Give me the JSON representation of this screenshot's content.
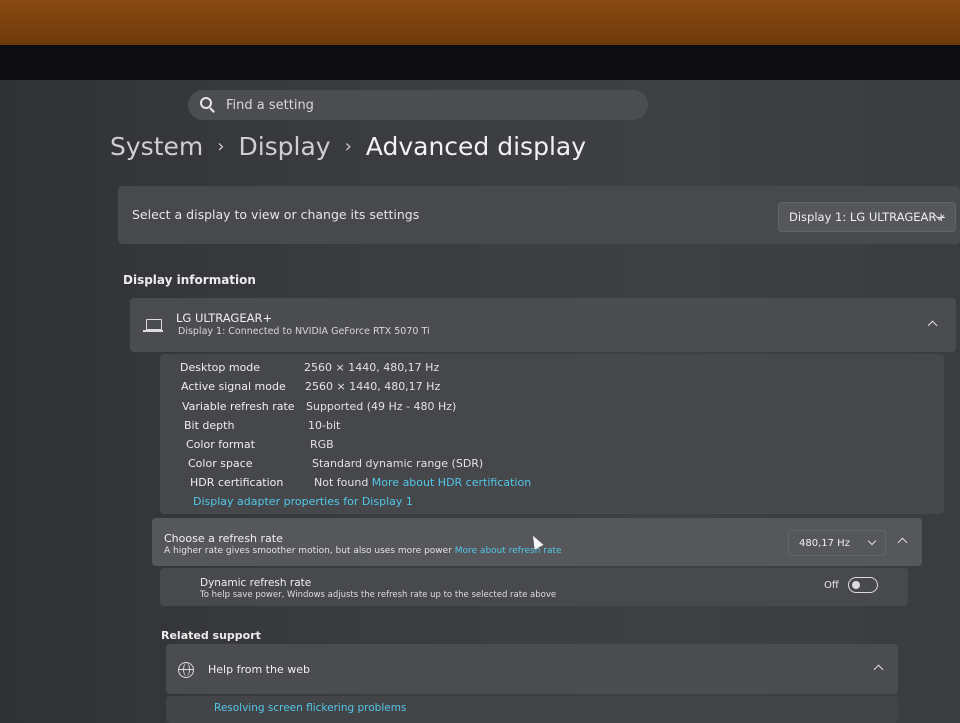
{
  "search": {
    "placeholder": "Find a setting"
  },
  "breadcrumb": {
    "level1": "System",
    "level2": "Display",
    "level3": "Advanced display",
    "separator": "›"
  },
  "display_select": {
    "label": "Select a display to view or change its settings",
    "selected": "Display 1: LG ULTRAGEAR+"
  },
  "display_info": {
    "heading": "Display information",
    "monitor_name": "LG ULTRAGEAR+",
    "monitor_sub": "Display 1: Connected to NVIDIA GeForce RTX 5070 Ti",
    "rows": [
      {
        "key": "Desktop mode",
        "value": "2560 × 1440, 480,17 Hz"
      },
      {
        "key": "Active signal mode",
        "value": "2560 × 1440, 480,17 Hz"
      },
      {
        "key": "Variable refresh rate",
        "value": "Supported (49 Hz - 480 Hz)"
      },
      {
        "key": "Bit depth",
        "value": "10-bit"
      },
      {
        "key": "Color format",
        "value": "RGB"
      },
      {
        "key": "Color space",
        "value": "Standard dynamic range (SDR)"
      },
      {
        "key": "HDR certification",
        "value": "Not found",
        "link": "More about HDR certification"
      }
    ],
    "adapter_link": "Display adapter properties for Display 1"
  },
  "refresh_rate": {
    "title": "Choose a refresh rate",
    "desc": "A higher rate gives smoother motion, but also uses more power",
    "link": "More about refresh rate",
    "selected": "480,17 Hz"
  },
  "dynamic_refresh": {
    "title": "Dynamic refresh rate",
    "desc": "To help save power, Windows adjusts the refresh rate up to the selected rate above",
    "state": "Off"
  },
  "related_support": {
    "heading": "Related support",
    "help_title": "Help from the web",
    "link1": "Resolving screen flickering problems"
  },
  "colors": {
    "accent_link": "#53c7e8",
    "panel": "#45474b",
    "background": "#2a2c2f"
  }
}
